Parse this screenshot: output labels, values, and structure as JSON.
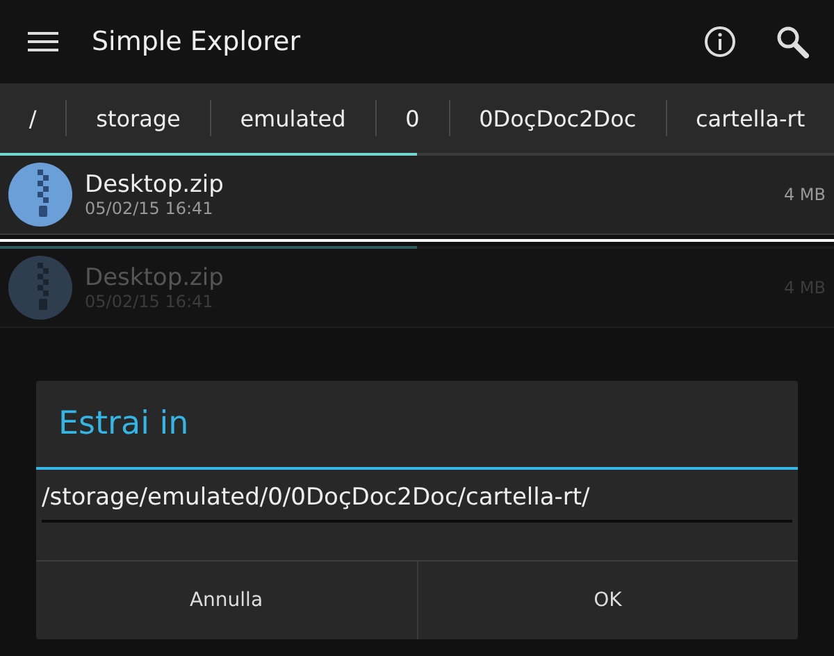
{
  "app_bar": {
    "title": "Simple Explorer"
  },
  "breadcrumbs": [
    {
      "label": "/"
    },
    {
      "label": "storage"
    },
    {
      "label": "emulated"
    },
    {
      "label": "0"
    },
    {
      "label": "0DoçDoc2Doc"
    },
    {
      "label": "cartella-rt"
    }
  ],
  "progress": {
    "level": 0.5
  },
  "files": [
    {
      "name": "Desktop.zip",
      "date": "05/02/15 16:41",
      "size": "4 MB",
      "dimmed": false
    },
    {
      "name": "Desktop.zip",
      "date": "05/02/15 16:41",
      "size": "4 MB",
      "dimmed": true,
      "level": 0.5
    }
  ],
  "dialog": {
    "title": "Estrai in",
    "value": "/storage/emulated/0/0DoçDoc2Doc/cartella-rt/",
    "buttons": [
      "Annulla",
      "OK"
    ]
  }
}
